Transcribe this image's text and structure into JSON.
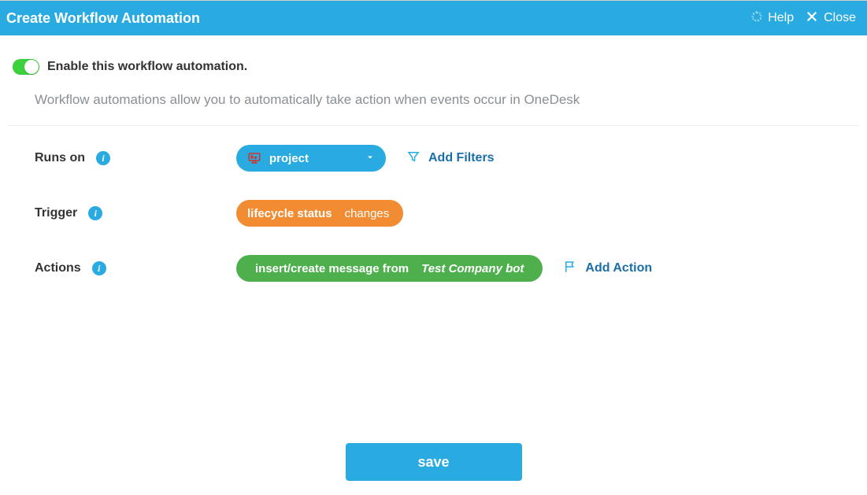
{
  "header": {
    "title": "Create Workflow Automation",
    "help_label": "Help",
    "close_label": "Close"
  },
  "enable": {
    "label": "Enable this workflow automation.",
    "on": true
  },
  "description": "Workflow automations allow you to automatically take action when events occur in OneDesk",
  "runs_on": {
    "label": "Runs on",
    "value": "project",
    "add_filters_label": "Add Filters"
  },
  "trigger": {
    "label": "Trigger",
    "field": "lifecycle status",
    "condition": "changes"
  },
  "actions": {
    "label": "Actions",
    "action_label": "insert/create message from",
    "action_value": "Test Company bot",
    "add_action_label": "Add Action"
  },
  "save_label": "save"
}
